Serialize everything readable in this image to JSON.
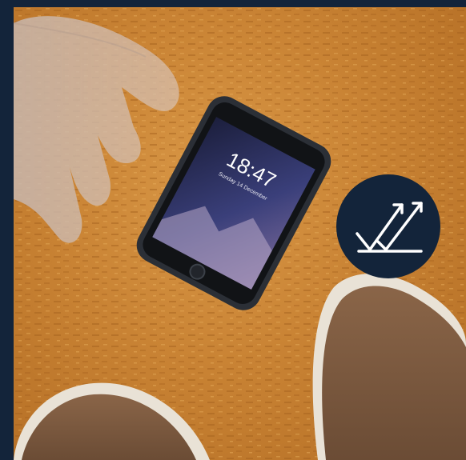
{
  "scene": {
    "phone_lockscreen": {
      "time": "18:47",
      "date": "Sunday 14 December"
    },
    "badge_icon": "double-checkmark-rising-arrows-icon"
  },
  "colors": {
    "frame": "#13243a",
    "badge": "#13243a",
    "floor": "#c98334",
    "shoe": "#7d5b40",
    "phone_body": "#2b2f36",
    "screen": "#2c2f5a"
  }
}
